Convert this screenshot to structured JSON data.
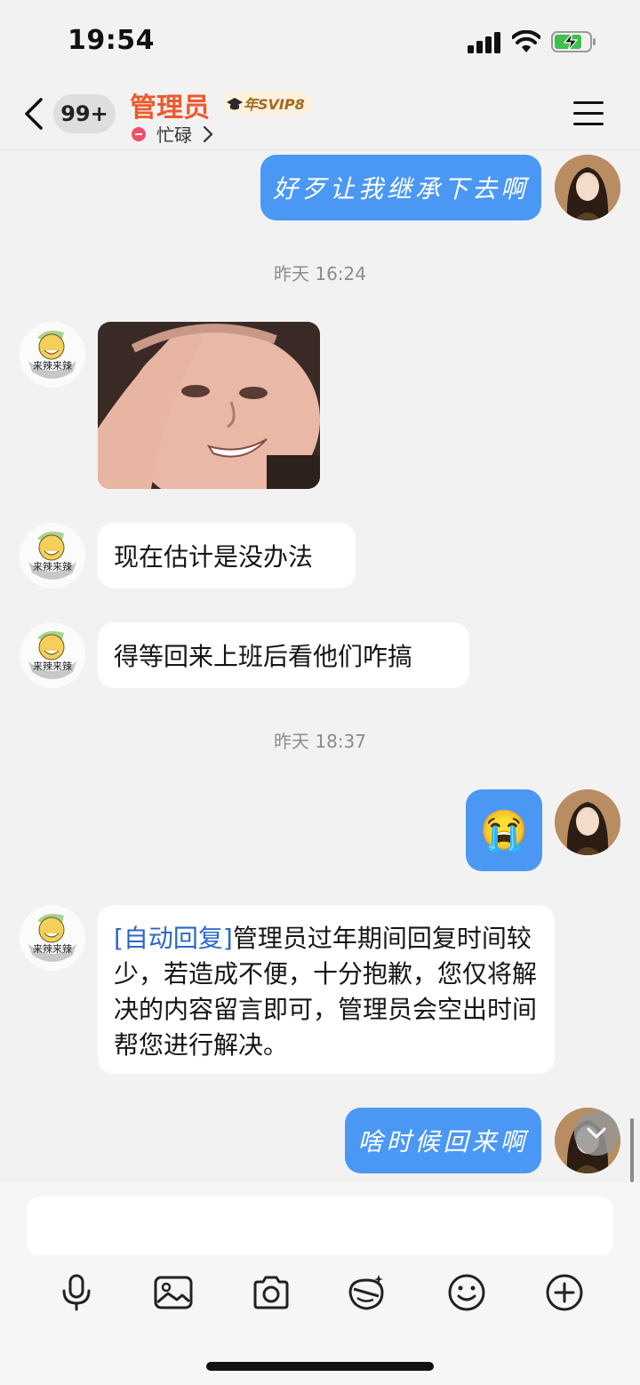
{
  "status_bar": {
    "time": "19:54"
  },
  "header": {
    "back_badge": "99+",
    "title": "管理员",
    "vip_badge": "年SVIP8",
    "status_text": "忙碌"
  },
  "messages": {
    "m1_text": "好歹让我继承下去啊",
    "ts1": "昨天 16:24",
    "m3_text": "现在估计是没办法",
    "m4_text": "得等回来上班后看他们咋搞",
    "ts2": "昨天 18:37",
    "m5_emoji": "😭",
    "auto_tag": "[自动回复]",
    "auto_text": "管理员过年期间回复时间较少，若造成不便，十分抱歉，您仅将解决的内容留言即可，管理员会空出时间帮您进行解决。",
    "m7_text": "啥时候回来啊"
  },
  "avatar_caption": "来辣来辣",
  "colors": {
    "accent_out": "#4b98f4",
    "title": "#ee5a2c",
    "auto_tag": "#2b67c7"
  },
  "icons": [
    "back-icon",
    "signal-icon",
    "wifi-icon",
    "battery-charging-icon",
    "menu-icon",
    "chevron-right-icon",
    "microphone-icon",
    "image-icon",
    "camera-icon",
    "sticker-icon",
    "emoji-icon",
    "plus-icon",
    "scroll-down-icon"
  ]
}
